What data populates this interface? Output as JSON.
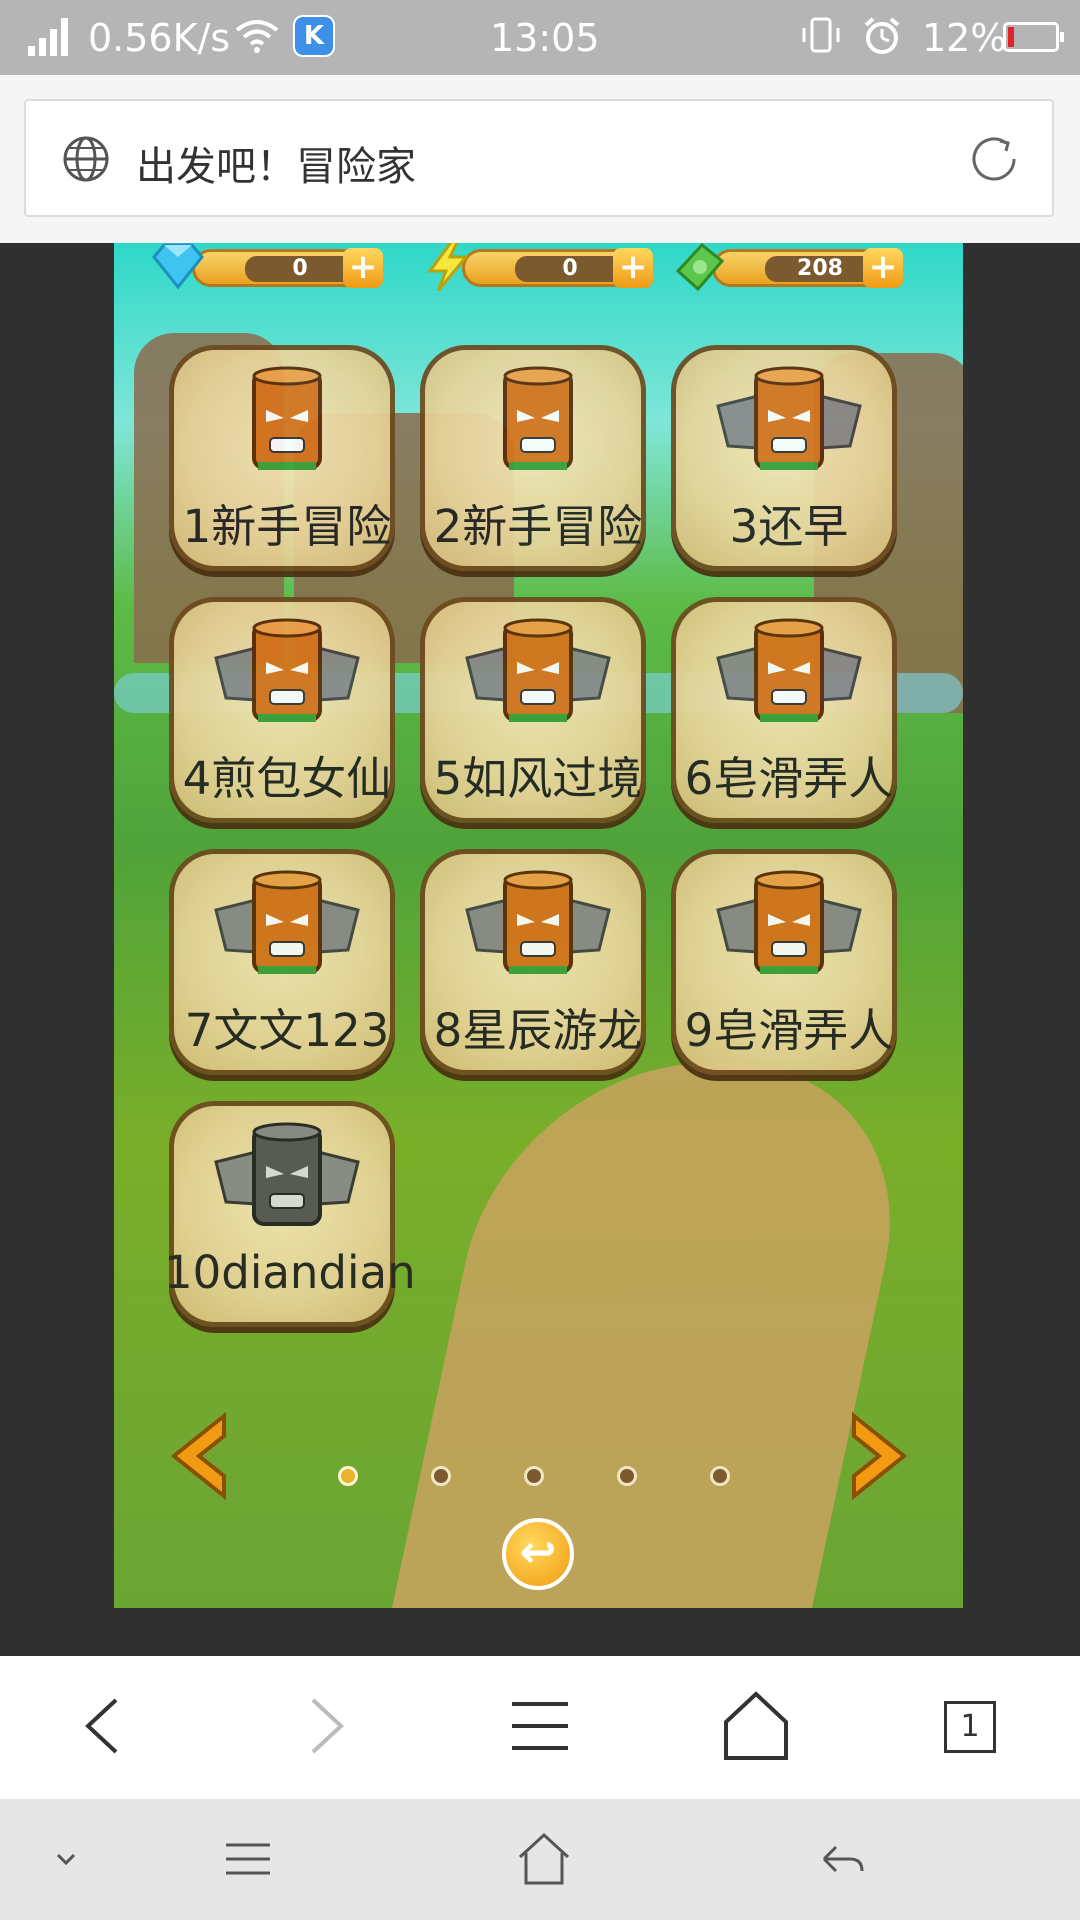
{
  "status_bar": {
    "net_speed": "0.56K/s",
    "app_icon_letter": "K",
    "time": "13:05",
    "battery": "12%",
    "icons": [
      "signal-icon",
      "wifi-icon",
      "vibrate-icon",
      "alarm-icon",
      "battery-icon"
    ]
  },
  "address_bar": {
    "title": "出发吧！冒险家"
  },
  "game": {
    "resources": [
      {
        "name": "diamond",
        "value": "0"
      },
      {
        "name": "energy",
        "value": "0"
      },
      {
        "name": "cash",
        "value": "208"
      }
    ],
    "plus_label": "+",
    "levels": [
      {
        "label": "1新手冒险",
        "locked": false
      },
      {
        "label": "2新手冒险",
        "locked": false
      },
      {
        "label": "3还早",
        "locked": false
      },
      {
        "label": "4煎包女仙",
        "locked": false
      },
      {
        "label": "5如风过境",
        "locked": false
      },
      {
        "label": "6皂滑弄人",
        "locked": false
      },
      {
        "label": "7文文123",
        "locked": false
      },
      {
        "label": "8星辰游龙",
        "locked": false
      },
      {
        "label": "9皂滑弄人",
        "locked": false
      },
      {
        "label": "10diandian",
        "locked": true
      }
    ],
    "page_indicator": {
      "pages": 5,
      "current": 1
    },
    "back_symbol": "↩"
  },
  "browser_toolbar": {
    "tab_count": "1"
  },
  "colors": {
    "accent": "#f29b10",
    "status_bar": "#b5b5b5",
    "battery_low": "#e0242b"
  }
}
